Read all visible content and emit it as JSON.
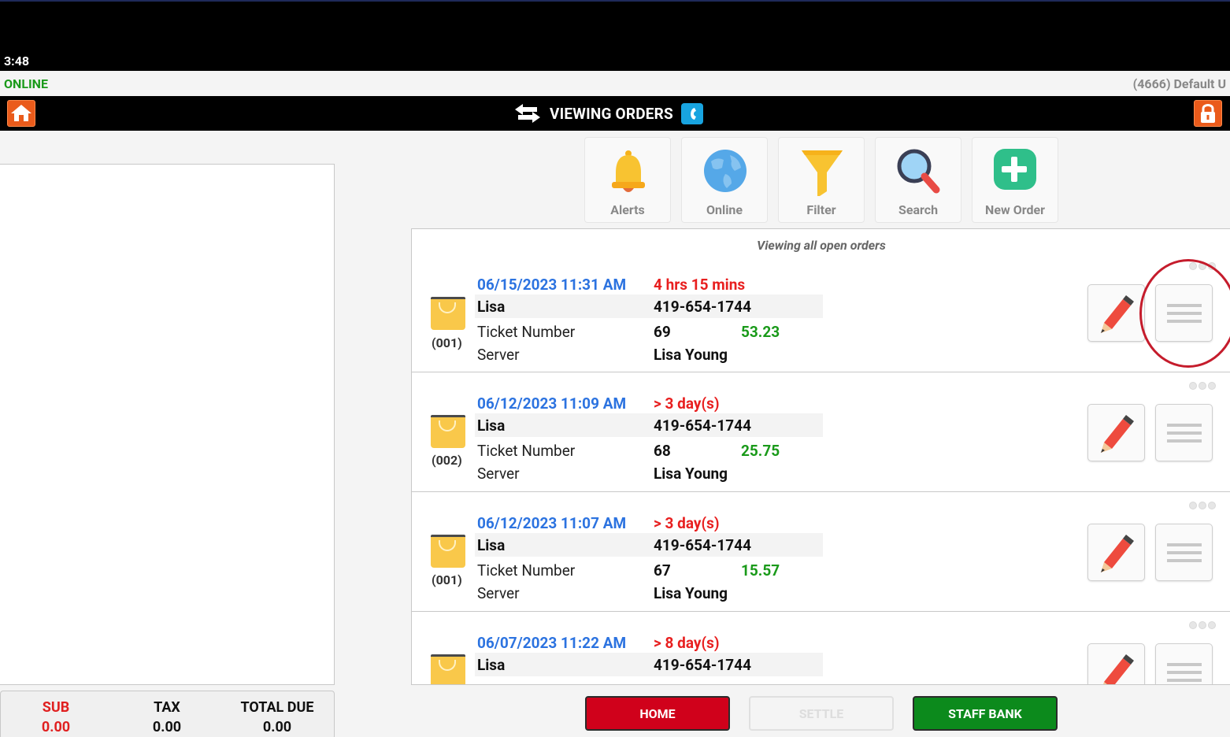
{
  "status_bar": {
    "time": "3:48"
  },
  "connection": {
    "status": "ONLINE",
    "user": "(4666) Default U"
  },
  "title_bar": {
    "title": "VIEWING ORDERS"
  },
  "toolbar": {
    "alerts_label": "Alerts",
    "online_label": "Online",
    "filter_label": "Filter",
    "search_label": "Search",
    "new_order_label": "New Order"
  },
  "orders": {
    "caption": "Viewing all open orders",
    "rows": [
      {
        "datetime": "06/15/2023 11:31 AM",
        "elapsed": "4 hrs 15 mins",
        "customer": "Lisa",
        "phone": "419-654-1744",
        "ticket_label": "Ticket Number",
        "ticket": "69",
        "amount": "53.23",
        "server_label": "Server",
        "server": "Lisa Young",
        "seat": "(001)"
      },
      {
        "datetime": "06/12/2023 11:09 AM",
        "elapsed": "> 3 day(s)",
        "customer": "Lisa",
        "phone": "419-654-1744",
        "ticket_label": "Ticket Number",
        "ticket": "68",
        "amount": "25.75",
        "server_label": "Server",
        "server": "Lisa Young",
        "seat": "(002)"
      },
      {
        "datetime": "06/12/2023 11:07 AM",
        "elapsed": "> 3 day(s)",
        "customer": "Lisa",
        "phone": "419-654-1744",
        "ticket_label": "Ticket Number",
        "ticket": "67",
        "amount": "15.57",
        "server_label": "Server",
        "server": "Lisa Young",
        "seat": "(001)"
      },
      {
        "datetime": "06/07/2023 11:22 AM",
        "elapsed": "> 8 day(s)",
        "customer": "Lisa",
        "phone": "419-654-1744"
      }
    ]
  },
  "totals": {
    "sub_label": "SUB",
    "sub_value": "0.00",
    "tax_label": "TAX",
    "tax_value": "0.00",
    "due_label": "TOTAL DUE",
    "due_value": "0.00"
  },
  "bottom": {
    "home_label": "HOME",
    "settle_label": "SETTLE",
    "staff_label": "STAFF BANK"
  },
  "colors": {
    "accent_orange": "#ea5b1b",
    "home_red": "#d0011b",
    "staff_green": "#0c8a1c",
    "date_blue": "#2c73e0",
    "elapsed_red": "#e81f1f",
    "amount_green": "#1a9a1a"
  }
}
